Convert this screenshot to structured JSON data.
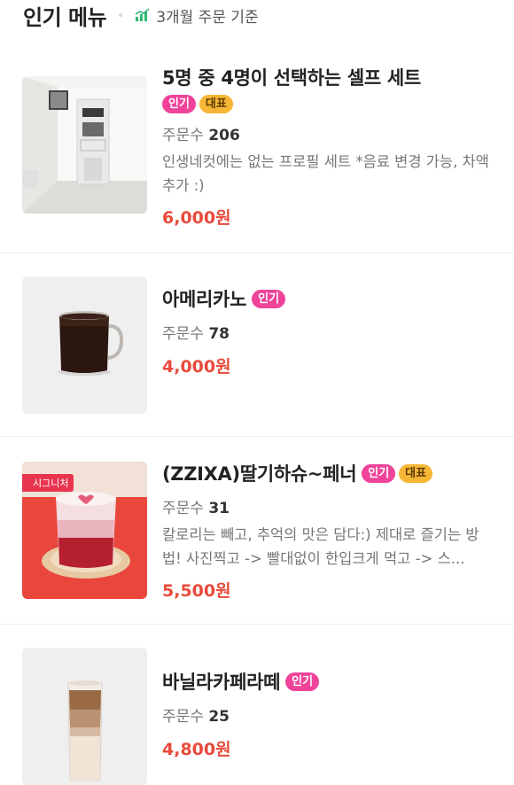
{
  "header": {
    "title": "인기 메뉴",
    "subtitle": "3개월 주문 기준"
  },
  "labels": {
    "orders_prefix": "주문수"
  },
  "colors": {
    "price": "#e84a3b",
    "badge_popular": "#f0439a",
    "badge_representative": "#f6b636"
  },
  "items": [
    {
      "name": "5명 중 4명이 선택하는 셀프 세트",
      "badges": [
        "인기",
        "대표"
      ],
      "orders": "206",
      "description": "인생네컷에는 없는 프로필 세트 *음료 변경 가능, 차액 추가 :)",
      "price": "6,000원",
      "image": "photo-booth-icon"
    },
    {
      "name": "아메리카노",
      "badges": [
        "인기"
      ],
      "orders": "78",
      "description": "",
      "price": "4,000원",
      "image": "americano-mug-icon"
    },
    {
      "name": "(ZZIXA)딸기하슈~페너",
      "badges": [
        "인기",
        "대표"
      ],
      "orders": "31",
      "description": "칼로리는 빼고, 추억의 맛은 담다:) 제대로 즐기는 방법! 사진찍고 -> 빨대없이 한입크게 먹고 -> 스...",
      "price": "5,500원",
      "image": "strawberry-drink-icon",
      "image_badge": "시그니처"
    },
    {
      "name": "바닐라카페라떼",
      "badges": [
        "인기"
      ],
      "orders": "25",
      "description": "",
      "price": "4,800원",
      "image": "iced-latte-icon"
    }
  ]
}
